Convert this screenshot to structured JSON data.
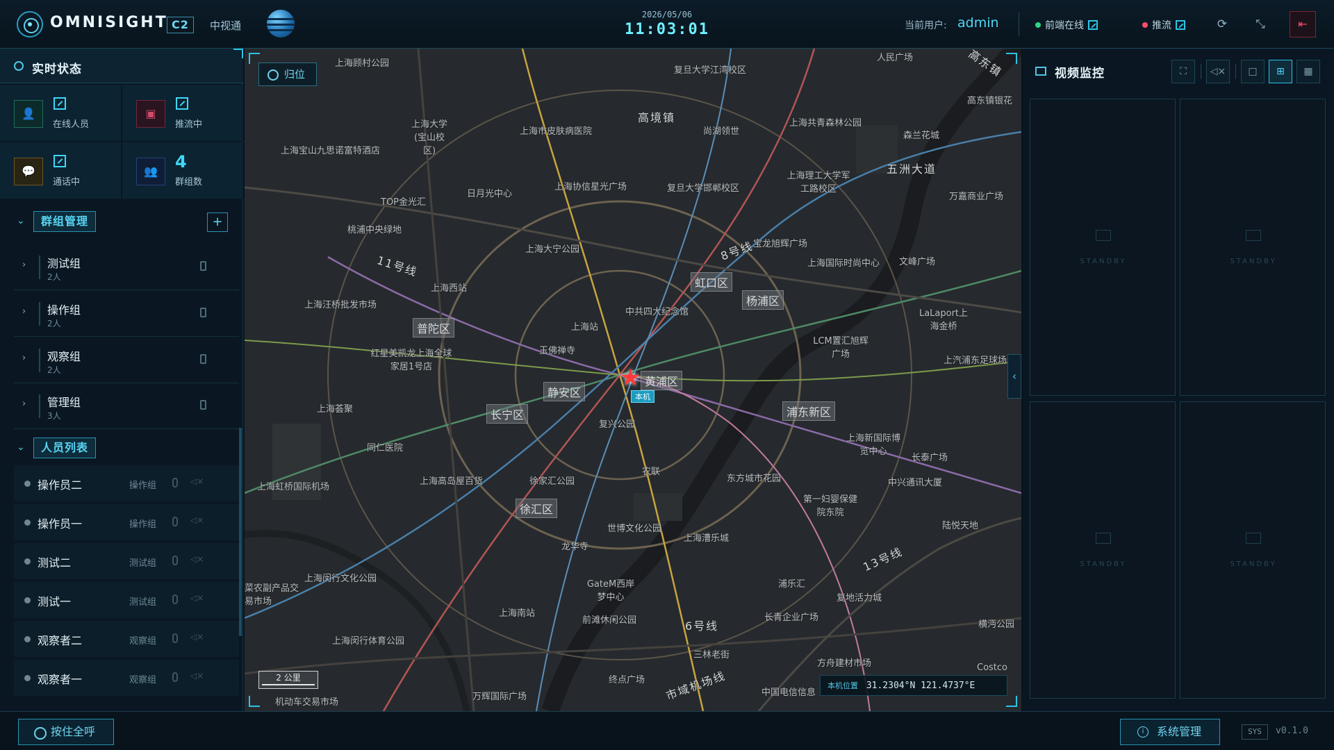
{
  "header": {
    "brand": "OMNISIGHT",
    "badge": "C2",
    "subtitle": "中视通",
    "date": "2026/05/06",
    "time": "11:03:01",
    "user_label": "当前用户:",
    "user_name": "admin",
    "status_front": "前端在线",
    "status_push": "推流",
    "icons": [
      "refresh-icon",
      "shrink-icon",
      "logout-icon"
    ]
  },
  "left": {
    "title": "实时状态",
    "stats": [
      {
        "label": "在线人员",
        "value_icon": "checkbox-icon",
        "color": "#2fd38a"
      },
      {
        "label": "推流中",
        "value_icon": "checkbox-icon",
        "color": "#d24a6a"
      },
      {
        "label": "通话中",
        "value_icon": "checkbox-icon",
        "color": "#d8a840"
      },
      {
        "label": "群组数",
        "value": "4",
        "color": "#3a7fd6"
      }
    ],
    "groups_title": "群组管理",
    "groups": [
      {
        "name": "测试组",
        "count": "2人"
      },
      {
        "name": "操作组",
        "count": "2人"
      },
      {
        "name": "观察组",
        "count": "2人"
      },
      {
        "name": "管理组",
        "count": "3人"
      }
    ],
    "members_title": "人员列表",
    "members": [
      {
        "name": "操作员二",
        "group": "操作组"
      },
      {
        "name": "操作员一",
        "group": "操作组"
      },
      {
        "name": "测试二",
        "group": "测试组"
      },
      {
        "name": "测试一",
        "group": "测试组"
      },
      {
        "name": "观察者二",
        "group": "观察组"
      },
      {
        "name": "观察者一",
        "group": "观察组"
      }
    ]
  },
  "map": {
    "home_label": "归位",
    "marker_label": "本机",
    "scale": "2 公里",
    "coord_label": "本机位置",
    "coord_value": "31.2304°N 121.4737°E",
    "labels": [
      "上海顾村公园",
      "复旦大学江湾校区",
      "人民广场",
      "高东镇",
      "上海大学(宝山校区)",
      "上海市皮肤病医院",
      "高境镇",
      "尚湖领世",
      "上海共青森林公园",
      "森兰花城",
      "上海宝山九思诺富特酒店",
      "高东镇银花",
      "五洲大道",
      "上海协信星光广场",
      "复旦大学邯郸校区",
      "日月光中心",
      "TOP金光汇",
      "上海理工大学军工路校区",
      "万嘉商业广场",
      "桃浦中央绿地",
      "上海大宁公园",
      "8号线",
      "宝龙旭辉广场",
      "上海国际时尚中心",
      "文峰广场",
      "11号线",
      "上海西站",
      "虹口区",
      "杨浦区",
      "中共四大纪念馆",
      "上海汪桥批发市场",
      "普陀区",
      "上海站",
      "LaLaport上海金桥",
      "LCM置汇旭辉广场",
      "红星美凯龙上海全球家居1号店",
      "玉佛禅寺",
      "黄浦区",
      "上汽浦东足球场",
      "静安区",
      "长宁区",
      "复兴公园",
      "浦东新区",
      "上海荟聚",
      "同仁医院",
      "上海新国际博览中心",
      "长泰广场",
      "上海虹桥国际机场",
      "上海高岛屋百货",
      "徐家汇公园",
      "农联",
      "东方城市花园",
      "中兴通讯大厦",
      "徐汇区",
      "第一妇婴保健院东院",
      "陆悦天地",
      "世博文化公园",
      "上海漕乐城",
      "龙华寺",
      "13号线",
      "上海闵行文化公园",
      "GateM西岸梦中心",
      "浦乐汇",
      "复地活力城",
      "横沔公园",
      "上海南站",
      "前滩休闲公园",
      "6号线",
      "长青企业广场",
      "上海闵行体育公园",
      "三林老街",
      "方舟建材市场",
      "Costco",
      "终点广场",
      "市域机场线",
      "万辉国际广场",
      "中国电信信息",
      "机动车交易市场",
      "菜农副产品交易市场"
    ]
  },
  "video": {
    "title": "视频监控",
    "cells": [
      "STANDBY",
      "STANDBY",
      "STANDBY",
      "STANDBY"
    ],
    "icons": [
      "fullscreen-icon",
      "mute-icon",
      "layout-1-icon",
      "layout-4-icon",
      "layout-9-icon"
    ]
  },
  "footer": {
    "ptt": "按住全呼",
    "sys": "系统管理",
    "sys_tag": "SYS",
    "version": "v0.1.0"
  }
}
